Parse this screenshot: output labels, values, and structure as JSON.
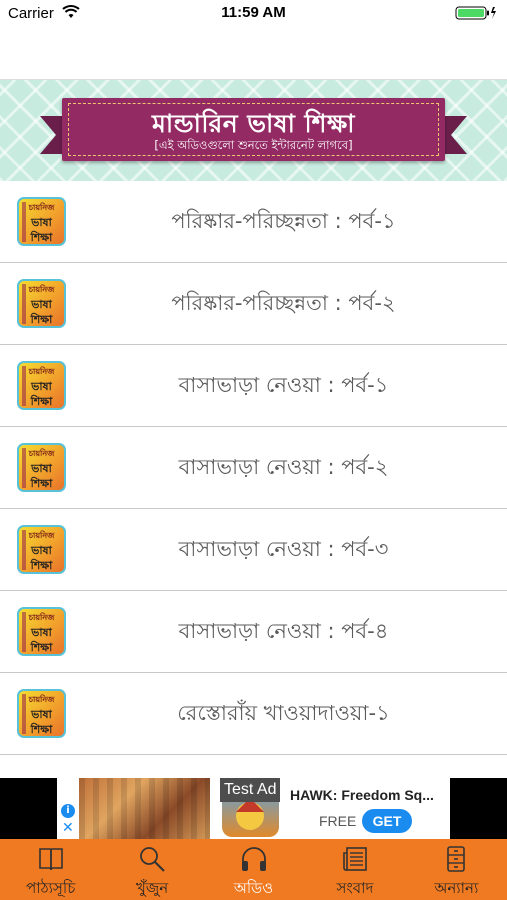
{
  "status_bar": {
    "carrier": "Carrier",
    "time": "11:59 AM"
  },
  "banner": {
    "title": "মান্ডারিন ভাষা শিক্ষা",
    "subtitle": "[এই অডিওগুলো শুনতে ইন্টারনেট লাগবে]"
  },
  "thumbnail": {
    "line1": "চায়নিজ",
    "line2": "ভাষা",
    "line3": "শিক্ষা"
  },
  "list": {
    "items": [
      {
        "title": "পরিষ্কার-পরিচ্ছন্নতা : পর্ব-১"
      },
      {
        "title": "পরিষ্কার-পরিচ্ছন্নতা : পর্ব-২"
      },
      {
        "title": "বাসাভাড়া নেওয়া : পর্ব-১"
      },
      {
        "title": "বাসাভাড়া নেওয়া : পর্ব-২"
      },
      {
        "title": "বাসাভাড়া নেওয়া : পর্ব-৩"
      },
      {
        "title": "বাসাভাড়া নেওয়া : পর্ব-৪"
      },
      {
        "title": "রেস্তোরাঁয় খাওয়াদাওয়া-১"
      }
    ]
  },
  "ad": {
    "badge": "Test Ad",
    "title": "HAWK: Freedom Sq...",
    "price": "FREE",
    "cta": "GET",
    "info": "i",
    "close": "✕"
  },
  "tabs": [
    {
      "label": "পাঠ্যসূচি",
      "icon": "book-icon",
      "active": false
    },
    {
      "label": "খুঁজুন",
      "icon": "search-icon",
      "active": false
    },
    {
      "label": "অডিও",
      "icon": "headphones-icon",
      "active": true
    },
    {
      "label": "সংবাদ",
      "icon": "newspaper-icon",
      "active": false
    },
    {
      "label": "অন্যান্য",
      "icon": "cabinet-icon",
      "active": false
    }
  ],
  "colors": {
    "tab_bar": "#f07a22",
    "ribbon": "#932a63",
    "banner_bg": "#c8ebe0",
    "ad_cta": "#1a8cf0"
  }
}
